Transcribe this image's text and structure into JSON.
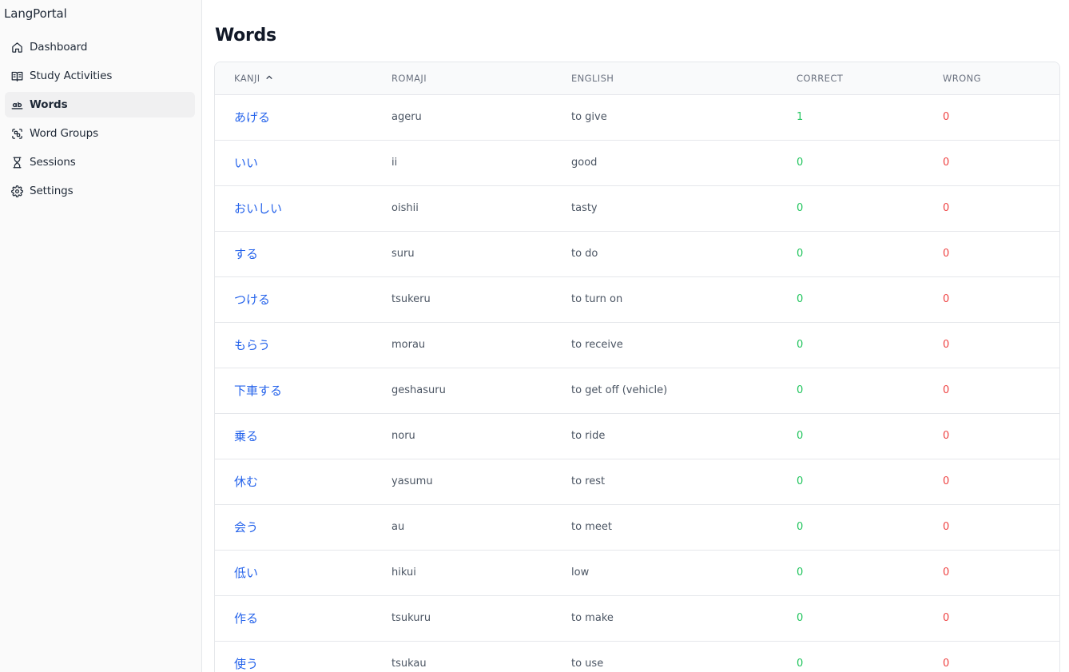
{
  "app": {
    "brand": "LangPortal"
  },
  "sidebar": {
    "items": [
      {
        "label": "Dashboard",
        "icon": "home-icon",
        "active": false
      },
      {
        "label": "Study Activities",
        "icon": "book-open-icon",
        "active": false
      },
      {
        "label": "Words",
        "icon": "whole-word-icon",
        "active": true
      },
      {
        "label": "Word Groups",
        "icon": "group-scan-icon",
        "active": false
      },
      {
        "label": "Sessions",
        "icon": "hourglass-icon",
        "active": false
      },
      {
        "label": "Settings",
        "icon": "gear-icon",
        "active": false
      }
    ]
  },
  "main": {
    "title": "Words",
    "table": {
      "columns": [
        "KANJI",
        "ROMAJI",
        "ENGLISH",
        "CORRECT",
        "WRONG"
      ],
      "sort": {
        "column": "KANJI",
        "direction": "ascending",
        "icon": "chevron-up-icon"
      },
      "rows": [
        {
          "kanji": "あげる",
          "romaji": "ageru",
          "english": "to give",
          "correct": "1",
          "wrong": "0"
        },
        {
          "kanji": "いい",
          "romaji": "ii",
          "english": "good",
          "correct": "0",
          "wrong": "0"
        },
        {
          "kanji": "おいしい",
          "romaji": "oishii",
          "english": "tasty",
          "correct": "0",
          "wrong": "0"
        },
        {
          "kanji": "する",
          "romaji": "suru",
          "english": "to do",
          "correct": "0",
          "wrong": "0"
        },
        {
          "kanji": "つける",
          "romaji": "tsukeru",
          "english": "to turn on",
          "correct": "0",
          "wrong": "0"
        },
        {
          "kanji": "もらう",
          "romaji": "morau",
          "english": "to receive",
          "correct": "0",
          "wrong": "0"
        },
        {
          "kanji": "下車する",
          "romaji": "geshasuru",
          "english": "to get off (vehicle)",
          "correct": "0",
          "wrong": "0"
        },
        {
          "kanji": "乗る",
          "romaji": "noru",
          "english": "to ride",
          "correct": "0",
          "wrong": "0"
        },
        {
          "kanji": "休む",
          "romaji": "yasumu",
          "english": "to rest",
          "correct": "0",
          "wrong": "0"
        },
        {
          "kanji": "会う",
          "romaji": "au",
          "english": "to meet",
          "correct": "0",
          "wrong": "0"
        },
        {
          "kanji": "低い",
          "romaji": "hikui",
          "english": "low",
          "correct": "0",
          "wrong": "0"
        },
        {
          "kanji": "作る",
          "romaji": "tsukuru",
          "english": "to make",
          "correct": "0",
          "wrong": "0"
        },
        {
          "kanji": "使う",
          "romaji": "tsukau",
          "english": "to use",
          "correct": "0",
          "wrong": "0"
        }
      ]
    }
  },
  "colors": {
    "link": "#2563eb",
    "correct": "#22c55e",
    "wrong": "#ef4444",
    "sidebar_bg": "#fafafa"
  }
}
